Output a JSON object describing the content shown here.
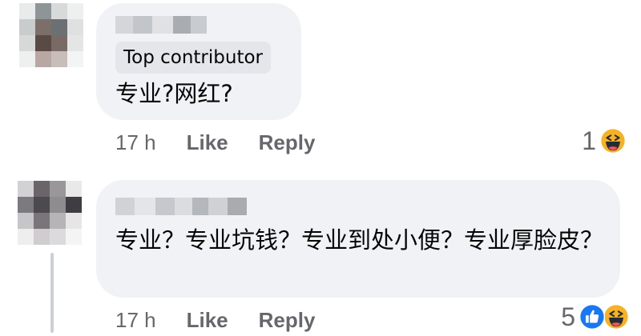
{
  "comments": [
    {
      "badge": "Top contributor",
      "text": "专业?网红?",
      "time": "17 h",
      "like_label": "Like",
      "reply_label": "Reply",
      "reaction_count": "1",
      "reaction_icons": [
        "haha-icon"
      ]
    },
    {
      "badge": "",
      "text": "专业？专业坑钱？专业到处小便？专业厚脸皮？",
      "time": "17 h",
      "like_label": "Like",
      "reply_label": "Reply",
      "reaction_count": "5",
      "reaction_icons": [
        "like-icon",
        "haha-icon"
      ]
    }
  ],
  "colors": {
    "bubble": "#f0f2f5",
    "meta_text": "#65676b",
    "like_blue": "#1877f2",
    "haha_yellow": "#f7b125"
  }
}
